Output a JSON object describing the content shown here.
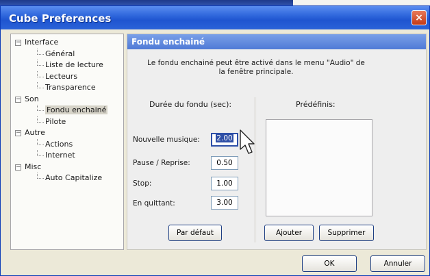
{
  "window": {
    "title": "Cube Preferences",
    "close_glyph": "×"
  },
  "tree": {
    "items": [
      {
        "label": "Interface",
        "level": 0,
        "expander": "⊟"
      },
      {
        "label": "Général",
        "level": 1
      },
      {
        "label": "Liste de lecture",
        "level": 1
      },
      {
        "label": "Lecteurs",
        "level": 1
      },
      {
        "label": "Transparence",
        "level": 1
      },
      {
        "label": "Son",
        "level": 0,
        "expander": "⊟"
      },
      {
        "label": "Fondu enchainé",
        "level": 1,
        "selected": true
      },
      {
        "label": "Pilote",
        "level": 1
      },
      {
        "label": "Autre",
        "level": 0,
        "expander": "⊟"
      },
      {
        "label": "Actions",
        "level": 1
      },
      {
        "label": "Internet",
        "level": 1
      },
      {
        "label": "Misc",
        "level": 0,
        "expander": "⊟"
      },
      {
        "label": "Auto Capitalize",
        "level": 1
      }
    ]
  },
  "panel": {
    "title": "Fondu enchainé",
    "description_line1": "Le fondu enchainé peut être activé dans le menu \"Audio\" de",
    "description_line2": "la fenêtre principale.",
    "durations_title": "Durée du fondu (sec):",
    "presets_title": "Prédéfinis:",
    "fields": [
      {
        "label": "Nouvelle musique:",
        "value": "2.00"
      },
      {
        "label": "Pause / Reprise:",
        "value": "0.50"
      },
      {
        "label": "Stop:",
        "value": "1.00"
      },
      {
        "label": "En quittant:",
        "value": "3.00"
      }
    ],
    "default_button": "Par défaut",
    "add_button": "Ajouter",
    "remove_button": "Supprimer"
  },
  "footer": {
    "ok_button": "OK",
    "cancel_button": "Annuler"
  },
  "colors": {
    "titlebar": "#2a62d8",
    "panel_header": "#5f88dc",
    "selection": "#2f4fa6",
    "close_button": "#c33a17"
  },
  "icons": {
    "close": "close-icon",
    "cursor": "mouse-pointer-icon",
    "expander": "tree-collapse-icon"
  }
}
